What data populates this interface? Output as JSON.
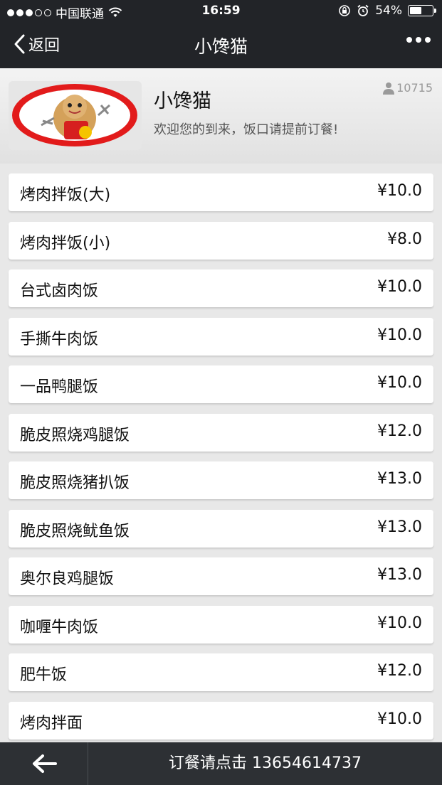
{
  "status_bar": {
    "signal_icon": "signal-dots-icon",
    "carrier": "中国联通",
    "wifi_icon": "wifi-icon",
    "time": "16:59",
    "lock_icon": "rotation-lock-icon",
    "alarm_icon": "alarm-icon",
    "battery_text": "54%",
    "battery_level": 0.54
  },
  "nav": {
    "back_label": "返回",
    "title": "小馋猫",
    "more_icon": "more-dots-icon"
  },
  "shop": {
    "name": "小馋猫",
    "welcome": "欢迎您的到来，饭口请提前订餐!",
    "visits": "10715",
    "logo_icon": "shop-logo-image"
  },
  "menu": [
    {
      "name": "烤肉拌饭(大)",
      "price": "¥10.0"
    },
    {
      "name": "烤肉拌饭(小)",
      "price": "¥8.0"
    },
    {
      "name": "台式卤肉饭",
      "price": "¥10.0"
    },
    {
      "name": "手撕牛肉饭",
      "price": "¥10.0"
    },
    {
      "name": "一品鸭腿饭",
      "price": "¥10.0"
    },
    {
      "name": "脆皮照烧鸡腿饭",
      "price": "¥12.0"
    },
    {
      "name": "脆皮照烧猪扒饭",
      "price": "¥13.0"
    },
    {
      "name": "脆皮照烧鱿鱼饭",
      "price": "¥13.0"
    },
    {
      "name": "奥尔良鸡腿饭",
      "price": "¥13.0"
    },
    {
      "name": "咖喱牛肉饭",
      "price": "¥10.0"
    },
    {
      "name": "肥牛饭",
      "price": "¥12.0"
    },
    {
      "name": "烤肉拌面",
      "price": "¥10.0"
    }
  ],
  "bottom_bar": {
    "back_icon": "arrow-left-icon",
    "order_text": "订餐请点击 13654614737"
  }
}
